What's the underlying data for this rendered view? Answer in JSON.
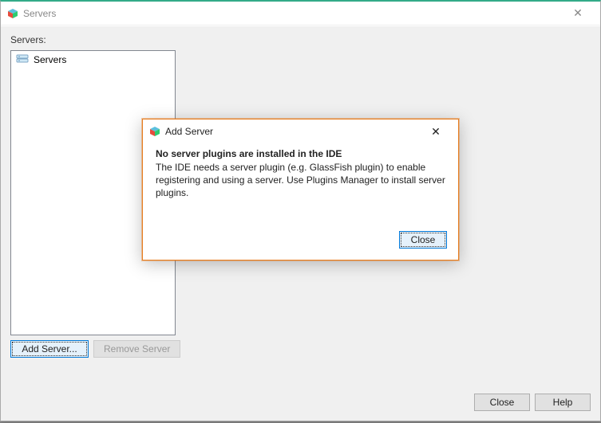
{
  "mainWindow": {
    "title": "Servers",
    "serversLabel": "Servers:",
    "treeRootLabel": "Servers",
    "addServerBtn": "Add Server...",
    "removeServerBtn": "Remove Server",
    "closeBtn": "Close",
    "helpBtn": "Help"
  },
  "modal": {
    "title": "Add Server",
    "heading": "No server plugins are installed in the IDE",
    "body": "The IDE needs a server plugin (e.g. GlassFish plugin) to enable registering and using a server. Use Plugins Manager to install server plugins.",
    "closeBtn": "Close"
  }
}
